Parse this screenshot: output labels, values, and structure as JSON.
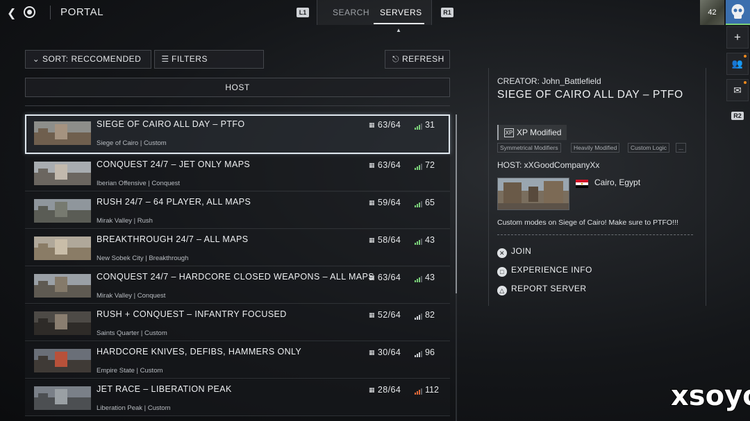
{
  "topbar": {
    "back_icon": "chevron-left-icon",
    "home_icon": "target-icon",
    "title": "PORTAL",
    "l1": "L1",
    "r1": "R1",
    "tabs": [
      {
        "label": "SEARCH",
        "active": false
      },
      {
        "label": "SERVERS",
        "active": true
      }
    ]
  },
  "profile": {
    "level": "42",
    "rail": [
      {
        "icon": "plus-icon",
        "glyph": "+"
      },
      {
        "icon": "friends-icon",
        "glyph": "👥"
      },
      {
        "icon": "mail-icon",
        "glyph": "✉"
      },
      {
        "icon": "r2-icon",
        "glyph": "R2"
      }
    ]
  },
  "controls": {
    "sort_label": "SORT: RECCOMENDED",
    "filters_label": "FILTERS",
    "refresh_label": "REFRESH",
    "host_label": "HOST"
  },
  "servers": [
    {
      "name": "SIEGE OF CAIRO ALL DAY – PTFO",
      "sub": "Siege of Cairo | Custom",
      "players": "63/64",
      "ping": "31",
      "ping_color": "#7bd17a",
      "selected": true
    },
    {
      "name": "CONQUEST 24/7 – JET ONLY MAPS",
      "sub": "Iberian Offensive | Conquest",
      "players": "63/64",
      "ping": "72",
      "ping_color": "#7bd17a",
      "selected": false
    },
    {
      "name": "RUSH 24/7 – 64  PLAYER, ALL MAPS",
      "sub": "Mirak Valley | Rush",
      "players": "59/64",
      "ping": "65",
      "ping_color": "#7bd17a",
      "selected": false
    },
    {
      "name": "BREAKTHROUGH 24/7 – ALL MAPS",
      "sub": "New Sobek City | Breakthrough",
      "players": "58/64",
      "ping": "43",
      "ping_color": "#7bd17a",
      "selected": false
    },
    {
      "name": "CONQUEST 24/7 – HARDCORE CLOSED WEAPONS – ALL MAPS",
      "sub": "Mirak Valley | Conquest",
      "players": "63/64",
      "ping": "43",
      "ping_color": "#7bd17a",
      "selected": false
    },
    {
      "name": "RUSH + CONQUEST – INFANTRY FOCUSED",
      "sub": "Saints Quarter | Custom",
      "players": "52/64",
      "ping": "82",
      "ping_color": "#cfd2d6",
      "selected": false
    },
    {
      "name": "HARDCORE KNIVES, DEFIBS, HAMMERS ONLY",
      "sub": "Empire State | Custom",
      "players": "30/64",
      "ping": "96",
      "ping_color": "#cfd2d6",
      "selected": false
    },
    {
      "name": "JET RACE – LIBERATION PEAK",
      "sub": "Liberation Peak | Custom",
      "players": "28/64",
      "ping": "112",
      "ping_color": "#e06a3a",
      "selected": false
    }
  ],
  "details": {
    "creator": "CREATOR:  John_Battlefield",
    "title": "SIEGE OF CAIRO ALL DAY – PTFO",
    "xp_label": "XP Modified",
    "xp_icon": "XP",
    "tags": [
      "Symmetrical Modifiers",
      "Heavily Modified",
      "Custom Logic",
      "..."
    ],
    "host": "HOST:  xXGoodCompanyXx",
    "location": "Cairo, Egypt",
    "description": "Custom modes on Siege of Cairo! Make sure to PTFO!!!",
    "actions": [
      {
        "label": "JOIN",
        "icon": "cross-button-icon",
        "glyph": "✕"
      },
      {
        "label": "EXPERIENCE INFO",
        "icon": "square-button-icon",
        "glyph": "□"
      },
      {
        "label": "REPORT SERVER",
        "icon": "triangle-button-icon",
        "glyph": "△"
      }
    ]
  },
  "watermark": "xsoyo"
}
